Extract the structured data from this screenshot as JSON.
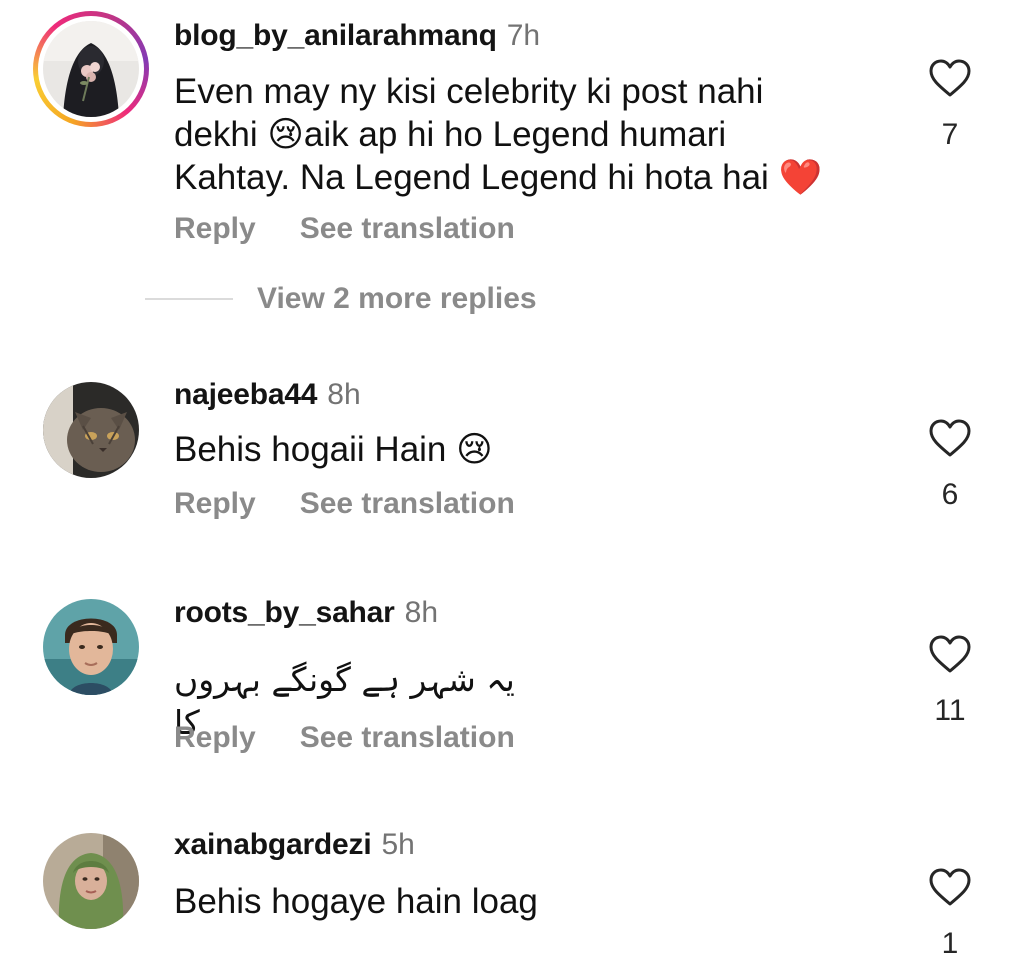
{
  "comments": [
    {
      "username": "blog_by_anilarahmanq",
      "time": "7h",
      "text_lines": [
        "Even may ny kisi celebrity ki post nahi",
        "dekhi 😢aik ap hi ho Legend humari",
        "Kahtay. Na Legend Legend hi hota hai ❤️"
      ],
      "reply_label": "Reply",
      "translate_label": "See translation",
      "likes": "7",
      "avatar_icon": "avatar-woman-niqab-roses",
      "has_story_ring": true
    },
    {
      "username": "najeeba44",
      "time": "8h",
      "text": "Behis hogaii Hain 😢",
      "reply_label": "Reply",
      "translate_label": "See translation",
      "likes": "6",
      "avatar_icon": "avatar-cat"
    },
    {
      "username": "roots_by_sahar",
      "time": "8h",
      "text": "یہ شہر ہے گونگے بہروں کا",
      "reply_label": "Reply",
      "translate_label": "See translation",
      "likes": "11",
      "avatar_icon": "avatar-man-portrait"
    },
    {
      "username": "xainabgardezi",
      "time": "5h",
      "text": "Behis hogaye hain loag",
      "likes": "1",
      "avatar_icon": "avatar-woman-green-scarf"
    }
  ],
  "view_more_replies": "View 2 more replies",
  "colors": {
    "username": "#141414",
    "secondary": "#737373",
    "action": "#8a8a8a",
    "divider": "#dbdbdb",
    "story_ring": [
      "#f9ce34",
      "#ee2a7b",
      "#833ab4"
    ]
  },
  "icons": {
    "like": "heart-outline-icon"
  }
}
